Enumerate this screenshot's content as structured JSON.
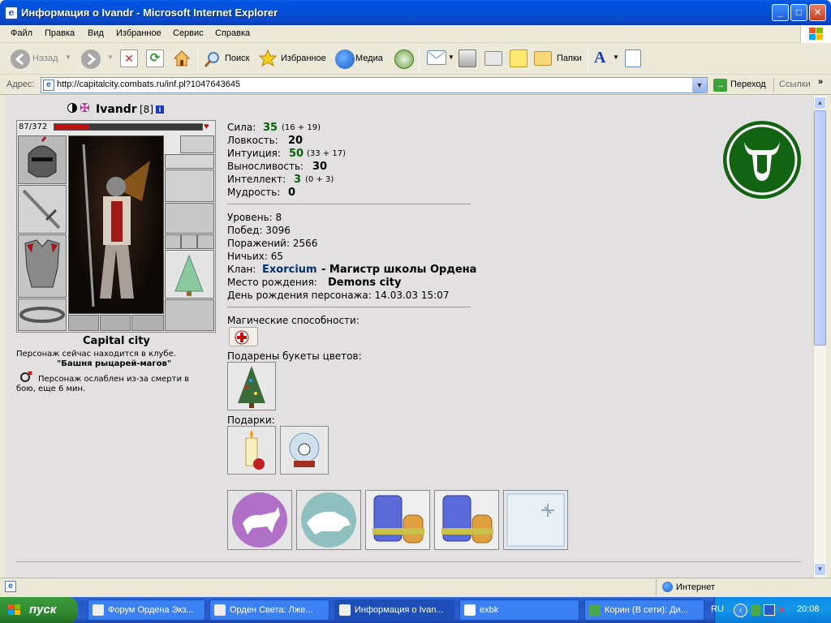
{
  "window": {
    "title": "Информация о Ivandr - Microsoft Internet Explorer"
  },
  "menu": [
    "Файл",
    "Правка",
    "Вид",
    "Избранное",
    "Сервис",
    "Справка"
  ],
  "toolbar": {
    "back": "Назад",
    "search": "Поиск",
    "favorites": "Избранное",
    "media": "Медиа",
    "folders": "Папки"
  },
  "address": {
    "label": "Адрес:",
    "url": "http://capitalcity.combats.ru/inf.pl?1047643645",
    "go": "Переход",
    "links": "Ссылки"
  },
  "status": {
    "zone": "Интернет"
  },
  "taskbar": {
    "start": "пуск",
    "tasks": [
      "Форум Ордена Экз...",
      "Орден Света: Лже...",
      "Информация о Ivan...",
      "exbk",
      "Корин (В сети): Ди..."
    ],
    "lang": "RU",
    "clock": "20:08"
  },
  "character": {
    "name": "Ivandr",
    "level": "[8]",
    "hp": "87/372",
    "hp_fraction": 0.234,
    "city": "Capital city",
    "location_text": "Персонаж сейчас находится в клубе.",
    "location_place": "\"Башня рыцарей-магов\"",
    "weakened_text": "Персонаж ослаблен из-за смерти в бою, еще 6 мин."
  },
  "stats": {
    "strength": {
      "label": "Сила:",
      "value": "35",
      "detail": "(16 + 19)"
    },
    "agility": {
      "label": "Ловкость:",
      "value": "20"
    },
    "intuition": {
      "label": "Интуиция:",
      "value": "50",
      "detail": "(33 + 17)"
    },
    "endurance": {
      "label": "Выносливость:",
      "value": "30"
    },
    "intellect": {
      "label": "Интеллект:",
      "value": "3",
      "detail": "(0 + 3)"
    },
    "wisdom": {
      "label": "Мудрость:",
      "value": "0"
    }
  },
  "info": {
    "level": "Уровень: 8",
    "wins": "Побед: 3096",
    "losses": "Поражений: 2566",
    "draws": "Ничьих: 65",
    "clan_label": "Клан:",
    "clan_name": "Exorcium",
    "clan_rank": "- Магистр школы Ордена",
    "birthplace_label": "Место рождения:",
    "birthplace": "Demons city",
    "birthday": "День рождения персонажа: 14.03.03 15:07"
  },
  "sections": {
    "magic": "Магические способности:",
    "flowers": "Подарены букеты цветов:",
    "gifts": "Подарки:"
  },
  "colors": {
    "clan": "#00306e",
    "stat_green": "#006400",
    "emblem": "#126312"
  }
}
